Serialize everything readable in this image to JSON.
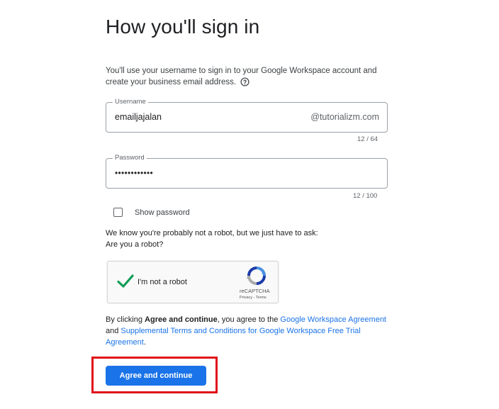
{
  "page": {
    "title": "How you'll sign in",
    "description": "You'll use your username to sign in to your Google Workspace account and create your business email address."
  },
  "username": {
    "label": "Username",
    "value": "emailjajalan",
    "suffix": "@tutorializm.com",
    "counter": "12 / 64"
  },
  "password": {
    "label": "Password",
    "value": "••••••••••••",
    "counter": "12 / 100"
  },
  "show_password": {
    "label": "Show password",
    "checked": false
  },
  "robot": {
    "line1": "We know you're probably not a robot, but we just have to ask:",
    "line2": "Are you a robot?"
  },
  "recaptcha": {
    "label": "I'm not a robot",
    "brand": "reCAPTCHA",
    "privacy": "Privacy",
    "separator": " - ",
    "terms": "Terms",
    "checked": true
  },
  "terms": {
    "prefix": "By clicking ",
    "bold": "Agree and continue",
    "middle": ", you agree to the ",
    "link1": "Google Workspace Agreement",
    "and": " and ",
    "link2": "Supplemental Terms and Conditions for Google Workspace Free Trial Agreement",
    "suffix": "."
  },
  "actions": {
    "agree_label": "Agree and continue"
  },
  "colors": {
    "primary": "#1a73e8",
    "highlight": "#e0101a",
    "check": "#0f9d58"
  }
}
